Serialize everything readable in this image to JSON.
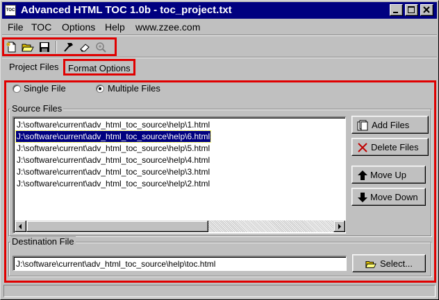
{
  "window": {
    "title": "Advanced HTML TOC 1.0b - toc_project.txt",
    "app_icon_label": "TOC"
  },
  "menu": {
    "items": [
      "File",
      "TOC",
      "Options",
      "Help",
      "www.zzee.com"
    ]
  },
  "toolbar": {
    "icons": [
      "new-file-icon",
      "open-folder-icon",
      "save-disk-icon",
      "hammer-icon",
      "eraser-icon",
      "zoom-icon"
    ]
  },
  "tabs": {
    "project_files": "Project Files",
    "format_options": "Format Options"
  },
  "mode": {
    "single_label": "Single File",
    "multiple_label": "Multiple Files",
    "selected": "multiple"
  },
  "source_files": {
    "group_label": "Source Files",
    "items": [
      "J:\\software\\current\\adv_html_toc_source\\help\\1.html",
      "J:\\software\\current\\adv_html_toc_source\\help\\6.html",
      "J:\\software\\current\\adv_html_toc_source\\help\\5.html",
      "J:\\software\\current\\adv_html_toc_source\\help\\4.html",
      "J:\\software\\current\\adv_html_toc_source\\help\\3.html",
      "J:\\software\\current\\adv_html_toc_source\\help\\2.html"
    ],
    "selected_index": 1,
    "buttons": {
      "add": "Add Files",
      "delete": "Delete Files",
      "move_up": "Move Up",
      "move_down": "Move Down"
    }
  },
  "destination": {
    "group_label": "Destination File",
    "value": "J:\\software\\current\\adv_html_toc_source\\help\\toc.html",
    "select_label": "Select..."
  },
  "colors": {
    "highlight_box": "#e00000",
    "title_bar": "#000080",
    "selection": "#000080"
  }
}
